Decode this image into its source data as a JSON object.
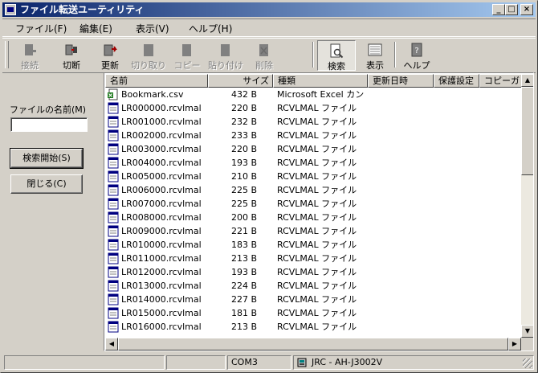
{
  "window": {
    "title": "ファイル転送ユーティリティ"
  },
  "title_buttons": [
    "_",
    "□",
    "×"
  ],
  "menu": [
    {
      "label": "ファイル(F)",
      "name": "menu-file"
    },
    {
      "label": "編集(E)",
      "name": "menu-edit"
    },
    {
      "label": "表示(V)",
      "name": "menu-view"
    },
    {
      "label": "ヘルプ(H)",
      "name": "menu-help"
    }
  ],
  "toolbar": [
    {
      "label": "接続",
      "name": "connect-button",
      "icon": "connect-icon",
      "enabled": false
    },
    {
      "label": "切断",
      "name": "disconnect-button",
      "icon": "disconnect-icon",
      "enabled": true
    },
    {
      "label": "更新",
      "name": "refresh-button",
      "icon": "refresh-icon",
      "enabled": true
    },
    {
      "label": "切り取り",
      "name": "cut-button",
      "icon": "cut-icon",
      "enabled": false
    },
    {
      "label": "コピー",
      "name": "copy-button",
      "icon": "copy-icon",
      "enabled": false
    },
    {
      "label": "貼り付け",
      "name": "paste-button",
      "icon": "paste-icon",
      "enabled": false
    },
    {
      "label": "削除",
      "name": "delete-button",
      "icon": "delete-icon",
      "enabled": false
    },
    {
      "label": "検索",
      "name": "search-button",
      "icon": "search-icon",
      "enabled": true,
      "pressed": true
    },
    {
      "label": "表示",
      "name": "view-button",
      "icon": "view-icon",
      "enabled": true
    },
    {
      "label": "ヘルプ",
      "name": "help-button",
      "icon": "help-icon",
      "enabled": true
    }
  ],
  "search_panel": {
    "filename_label": "ファイルの名前(M)",
    "filename_value": "",
    "start_button": "検索開始(S)",
    "close_button": "閉じる(C)"
  },
  "columns": [
    "名前",
    "サイズ",
    "種類",
    "更新日時",
    "保護設定",
    "コピーガ"
  ],
  "files": [
    {
      "name": "Bookmark.csv",
      "size": "432 B",
      "type": "Microsoft Excel カン",
      "icon": "excel-file-icon"
    },
    {
      "name": "LR000000.rcvlmal",
      "size": "220 B",
      "type": "RCVLMAL ファイル",
      "icon": "rcvlmal-file-icon"
    },
    {
      "name": "LR001000.rcvlmal",
      "size": "232 B",
      "type": "RCVLMAL ファイル",
      "icon": "rcvlmal-file-icon"
    },
    {
      "name": "LR002000.rcvlmal",
      "size": "233 B",
      "type": "RCVLMAL ファイル",
      "icon": "rcvlmal-file-icon"
    },
    {
      "name": "LR003000.rcvlmal",
      "size": "220 B",
      "type": "RCVLMAL ファイル",
      "icon": "rcvlmal-file-icon"
    },
    {
      "name": "LR004000.rcvlmal",
      "size": "193 B",
      "type": "RCVLMAL ファイル",
      "icon": "rcvlmal-file-icon"
    },
    {
      "name": "LR005000.rcvlmal",
      "size": "210 B",
      "type": "RCVLMAL ファイル",
      "icon": "rcvlmal-file-icon"
    },
    {
      "name": "LR006000.rcvlmal",
      "size": "225 B",
      "type": "RCVLMAL ファイル",
      "icon": "rcvlmal-file-icon"
    },
    {
      "name": "LR007000.rcvlmal",
      "size": "225 B",
      "type": "RCVLMAL ファイル",
      "icon": "rcvlmal-file-icon"
    },
    {
      "name": "LR008000.rcvlmal",
      "size": "200 B",
      "type": "RCVLMAL ファイル",
      "icon": "rcvlmal-file-icon"
    },
    {
      "name": "LR009000.rcvlmal",
      "size": "221 B",
      "type": "RCVLMAL ファイル",
      "icon": "rcvlmal-file-icon"
    },
    {
      "name": "LR010000.rcvlmal",
      "size": "183 B",
      "type": "RCVLMAL ファイル",
      "icon": "rcvlmal-file-icon"
    },
    {
      "name": "LR011000.rcvlmal",
      "size": "213 B",
      "type": "RCVLMAL ファイル",
      "icon": "rcvlmal-file-icon"
    },
    {
      "name": "LR012000.rcvlmal",
      "size": "193 B",
      "type": "RCVLMAL ファイル",
      "icon": "rcvlmal-file-icon"
    },
    {
      "name": "LR013000.rcvlmal",
      "size": "224 B",
      "type": "RCVLMAL ファイル",
      "icon": "rcvlmal-file-icon"
    },
    {
      "name": "LR014000.rcvlmal",
      "size": "227 B",
      "type": "RCVLMAL ファイル",
      "icon": "rcvlmal-file-icon"
    },
    {
      "name": "LR015000.rcvlmal",
      "size": "181 B",
      "type": "RCVLMAL ファイル",
      "icon": "rcvlmal-file-icon"
    },
    {
      "name": "LR016000.rcvlmal",
      "size": "213 B",
      "type": "RCVLMAL ファイル",
      "icon": "rcvlmal-file-icon"
    }
  ],
  "statusbar": {
    "port": "COM3",
    "device": "JRC - AH-J3002V",
    "device_icon": "device-icon"
  },
  "colors": {
    "title_start": "#0a246a",
    "title_end": "#a6caf0",
    "face": "#d4d0c8"
  }
}
